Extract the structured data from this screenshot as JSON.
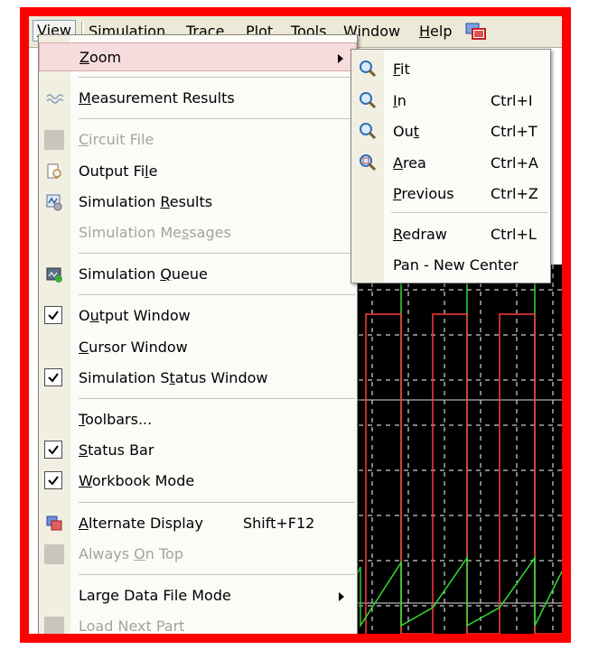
{
  "menubar": {
    "items": [
      {
        "label": "View",
        "mnemonic": 0
      },
      {
        "label": "Simulation",
        "mnemonic": 0
      },
      {
        "label": "Trace",
        "mnemonic": 0
      },
      {
        "label": "Plot",
        "mnemonic": 0
      },
      {
        "label": "Tools",
        "mnemonic": 1
      },
      {
        "label": "Window",
        "mnemonic": 0
      },
      {
        "label": "Help",
        "mnemonic": 0
      }
    ],
    "icon": "window-layout-icon"
  },
  "view_menu": {
    "items": [
      {
        "type": "item",
        "label": "Zoom",
        "mnemonic": 0,
        "submenu": true,
        "highlighted": true
      },
      {
        "type": "sep"
      },
      {
        "type": "item",
        "label": "Measurement Results",
        "mnemonic": 0,
        "icon": "measurement-wave-icon"
      },
      {
        "type": "sep"
      },
      {
        "type": "item",
        "label": "Circuit File",
        "mnemonic": 0,
        "disabled": true,
        "icon": "gray"
      },
      {
        "type": "item",
        "label": "Output File",
        "mnemonic": 9,
        "icon": "document-magnifier-icon"
      },
      {
        "type": "item",
        "label": "Simulation Results",
        "mnemonic": 11,
        "icon": "simulation-results-icon"
      },
      {
        "type": "item",
        "label": "Simulation Messages",
        "mnemonic": 13,
        "disabled": true
      },
      {
        "type": "sep"
      },
      {
        "type": "item",
        "label": "Simulation Queue",
        "mnemonic": 11,
        "icon": "simulation-queue-icon"
      },
      {
        "type": "sep"
      },
      {
        "type": "item",
        "label": "Output Window",
        "mnemonic": 1,
        "checked": true
      },
      {
        "type": "item",
        "label": "Cursor Window",
        "mnemonic": 0
      },
      {
        "type": "item",
        "label": "Simulation Status Window",
        "mnemonic": 12,
        "checked": true
      },
      {
        "type": "sep"
      },
      {
        "type": "item",
        "label": "Toolbars...",
        "mnemonic": 0
      },
      {
        "type": "item",
        "label": "Status Bar",
        "mnemonic": 0,
        "checked": true
      },
      {
        "type": "item",
        "label": "Workbook Mode",
        "mnemonic": 0,
        "checked": true
      },
      {
        "type": "sep"
      },
      {
        "type": "item",
        "label": "Alternate Display",
        "mnemonic": 0,
        "accel": "Shift+F12",
        "icon": "alternate-display-icon"
      },
      {
        "type": "item",
        "label": "Always On Top",
        "mnemonic": 7,
        "disabled": true,
        "icon": "gray"
      },
      {
        "type": "sep"
      },
      {
        "type": "item",
        "label": "Large Data File Mode",
        "submenu": true
      },
      {
        "type": "item",
        "label": "Load Next Part",
        "disabled": true,
        "icon": "gray"
      }
    ]
  },
  "zoom_menu": {
    "items": [
      {
        "type": "item",
        "label": "Fit",
        "mnemonic": 0,
        "icon": "zoom-fit-icon"
      },
      {
        "type": "item",
        "label": "In",
        "mnemonic": 0,
        "accel": "Ctrl+I",
        "icon": "zoom-in-icon"
      },
      {
        "type": "item",
        "label": "Out",
        "mnemonic": 2,
        "accel": "Ctrl+T",
        "icon": "zoom-out-icon"
      },
      {
        "type": "item",
        "label": "Area",
        "mnemonic": 0,
        "accel": "Ctrl+A",
        "icon": "zoom-area-icon"
      },
      {
        "type": "item",
        "label": "Previous",
        "mnemonic": 0,
        "accel": "Ctrl+Z"
      },
      {
        "type": "sep"
      },
      {
        "type": "item",
        "label": "Redraw",
        "mnemonic": 0,
        "accel": "Ctrl+L"
      },
      {
        "type": "item",
        "label": "Pan - New Center"
      }
    ]
  },
  "colors": {
    "frame": "#ff0000",
    "trace_green": "#33dd33",
    "trace_red": "#ff3b3b",
    "plot_bg": "#000000",
    "highlight": "#f6dcdc"
  }
}
